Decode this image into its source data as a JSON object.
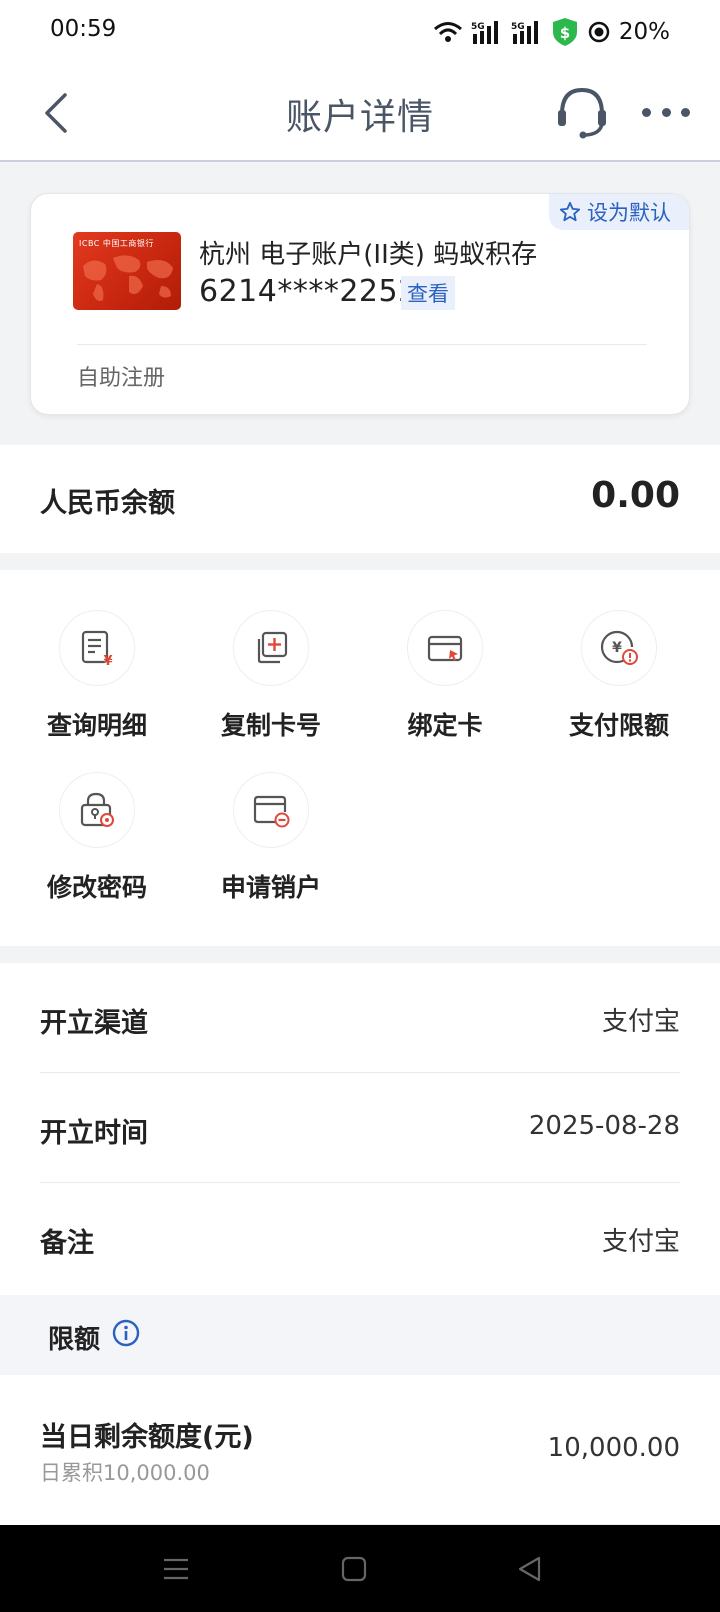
{
  "status_bar": {
    "time": "00:59",
    "battery": "20%",
    "network": "5G"
  },
  "header": {
    "title": "账户详情"
  },
  "card": {
    "default_label": "设为默认",
    "bank_logo_text": "ICBC 中国工商银行",
    "title": "杭州 电子账户(II类) 蚂蚁积存",
    "number": "6214****2252",
    "view_label": "查看",
    "footer": "自助注册"
  },
  "balance": {
    "label": "人民币余额",
    "value": "0.00"
  },
  "actions": [
    {
      "label": "查询明细",
      "icon": "statement-icon"
    },
    {
      "label": "复制卡号",
      "icon": "copy-card-icon"
    },
    {
      "label": "绑定卡",
      "icon": "bind-card-icon"
    },
    {
      "label": "支付限额",
      "icon": "payment-limit-icon"
    },
    {
      "label": "修改密码",
      "icon": "change-password-icon"
    },
    {
      "label": "申请销户",
      "icon": "close-account-icon"
    }
  ],
  "details": [
    {
      "key": "开立渠道",
      "value": "支付宝"
    },
    {
      "key": "开立时间",
      "value": "2025-08-28"
    },
    {
      "key": "备注",
      "value": "支付宝"
    }
  ],
  "limits": {
    "title": "限额",
    "daily_label": "当日剩余额度(元)",
    "daily_sub": "日累积10,000.00",
    "daily_value": "10,000.00"
  },
  "colors": {
    "accent": "#2b62c0",
    "icon_red": "#e0483a",
    "title_gray": "#4a5566"
  }
}
